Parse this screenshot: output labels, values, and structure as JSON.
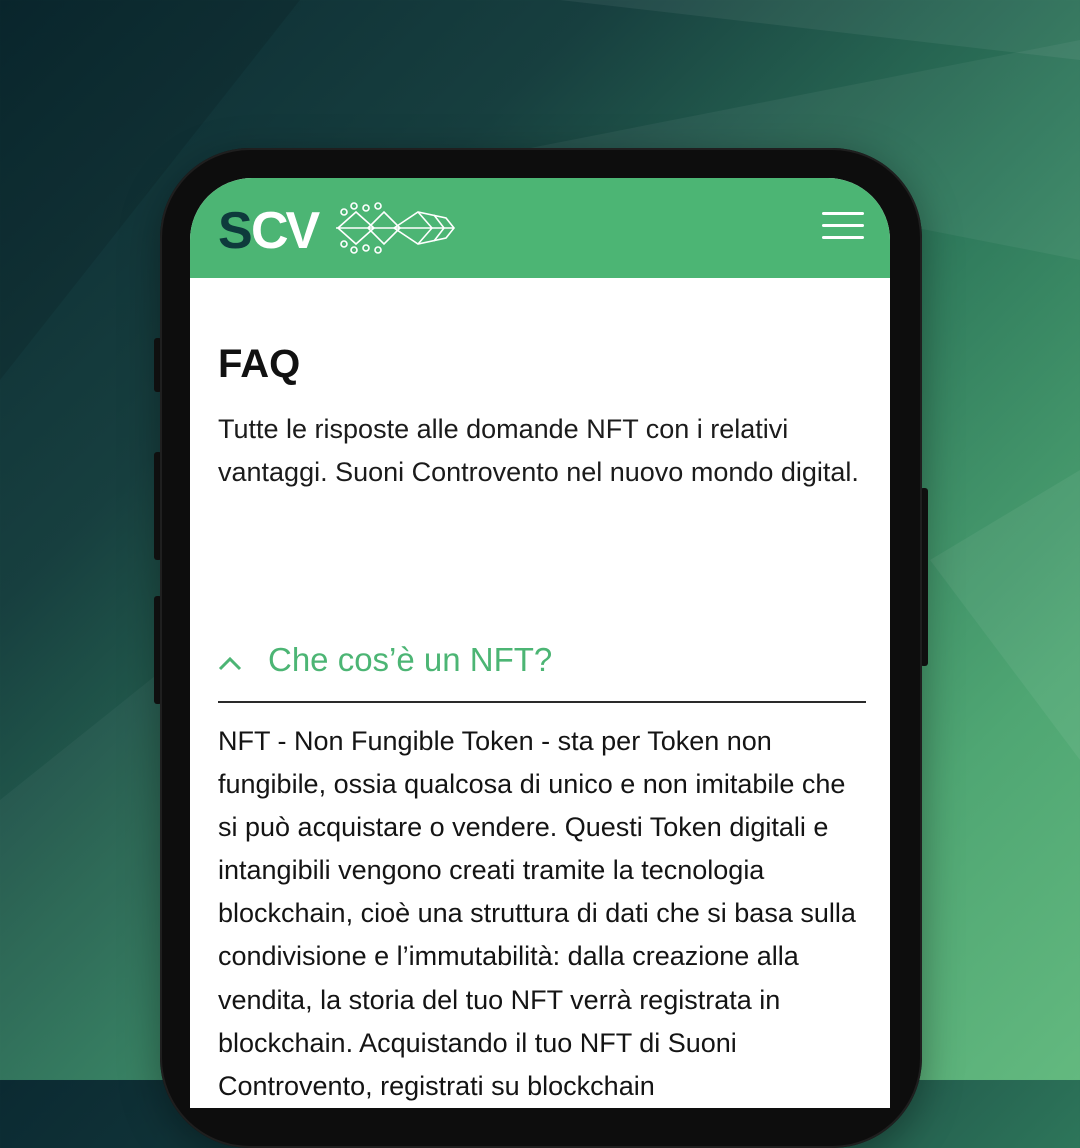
{
  "header": {
    "logo_text": "SCV",
    "menu_icon": "hamburger-menu-icon",
    "accent_color": "#4cb574"
  },
  "page": {
    "title": "FAQ",
    "intro": "Tutte le risposte alle domande NFT con i relativi vantaggi. Suoni Controvento nel nuovo mondo digital."
  },
  "faq": {
    "items": [
      {
        "expanded": true,
        "toggle_icon": "chevron-up-icon",
        "question": "Che cos’è un NFT?",
        "answer": "NFT - Non Fungible Token - sta per Token non fungibile, ossia qualcosa di unico e non imitabile che si può acquistare o vendere. Questi Token digitali e intangibili vengono creati tramite la tecnologia blockchain, cioè una struttura di dati che si basa sulla condivisione e l’immutabilità: dalla creazione alla vendita, la storia del tuo NFT verrà registrata in blockchain. Acquistando il tuo NFT di Suoni Controvento, registrati su blockchain"
      }
    ]
  }
}
